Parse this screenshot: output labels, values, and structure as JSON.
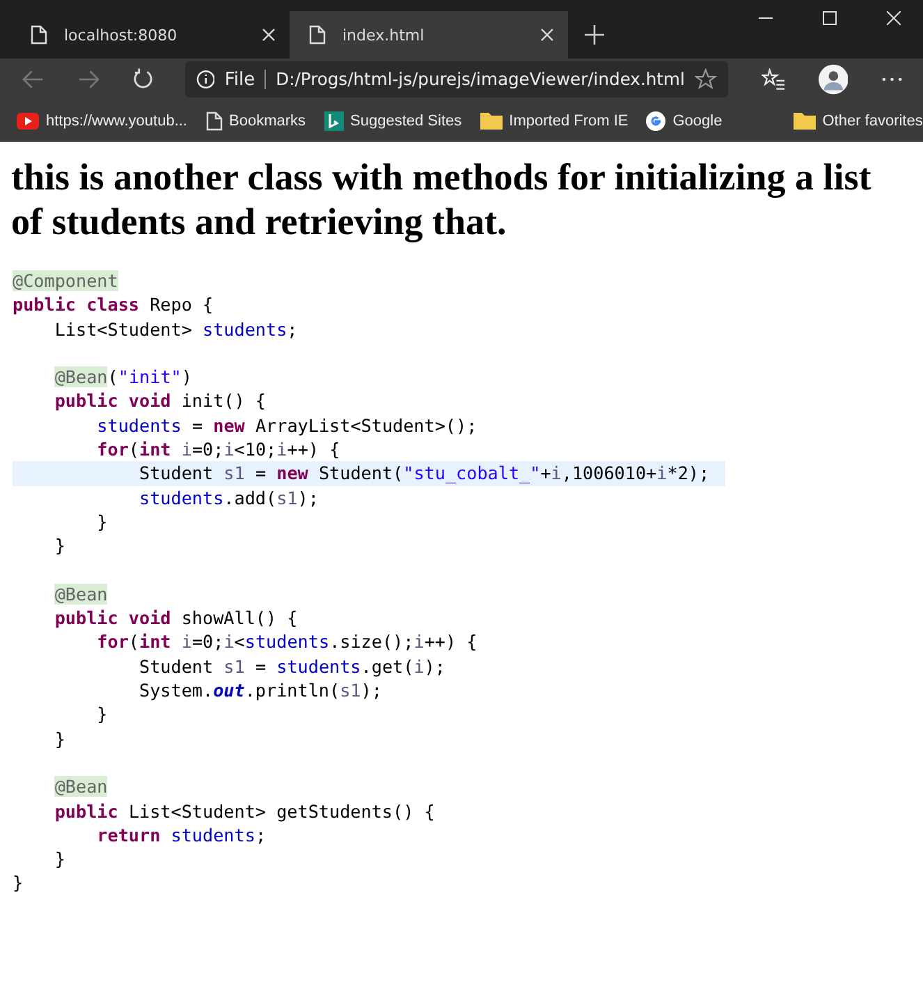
{
  "browser": {
    "tabs": [
      {
        "label": "localhost:8080",
        "selected": false
      },
      {
        "label": "index.html",
        "selected": true
      }
    ],
    "address": {
      "scheme": "File",
      "url": "D:/Progs/html-js/purejs/imageViewer/index.html"
    },
    "bookmarks": [
      {
        "label": "https://www.youtub...",
        "kind": "youtube"
      },
      {
        "label": "Bookmarks",
        "kind": "page"
      },
      {
        "label": "Suggested Sites",
        "kind": "bing"
      },
      {
        "label": "Imported From IE",
        "kind": "folder"
      },
      {
        "label": "Google",
        "kind": "google"
      }
    ],
    "other_favorites": "Other favorites"
  },
  "page": {
    "heading": "this is another class with methods for initializing a list of students and retrieving that.",
    "code": [
      {
        "kind": "code",
        "highlighted": false,
        "tokens": [
          {
            "text": "@Component",
            "kind": "ann"
          }
        ]
      },
      {
        "kind": "code",
        "highlighted": false,
        "tokens": [
          {
            "text": "public class",
            "kind": "kw"
          },
          {
            "text": " Repo {",
            "kind": "p"
          }
        ]
      },
      {
        "kind": "code",
        "highlighted": false,
        "tokens": [
          {
            "text": "    List<Student> ",
            "kind": "p"
          },
          {
            "text": "students",
            "kind": "field"
          },
          {
            "text": ";",
            "kind": "p"
          }
        ]
      },
      {
        "kind": "blank"
      },
      {
        "kind": "code",
        "highlighted": false,
        "tokens": [
          {
            "text": "    @Bean",
            "kind": "ann"
          },
          {
            "text": "(",
            "kind": "p"
          },
          {
            "text": "\"init\"",
            "kind": "str"
          },
          {
            "text": ")",
            "kind": "p"
          }
        ]
      },
      {
        "kind": "code",
        "highlighted": false,
        "tokens": [
          {
            "text": "    public void",
            "kind": "kw"
          },
          {
            "text": " init() {",
            "kind": "p"
          }
        ]
      },
      {
        "kind": "code",
        "highlighted": false,
        "tokens": [
          {
            "text": "        students",
            "kind": "field"
          },
          {
            "text": " = ",
            "kind": "p"
          },
          {
            "text": "new",
            "kind": "kw"
          },
          {
            "text": " ArrayList<Student>();",
            "kind": "p"
          }
        ]
      },
      {
        "kind": "code",
        "highlighted": false,
        "tokens": [
          {
            "text": "        for",
            "kind": "kw"
          },
          {
            "text": "(",
            "kind": "p"
          },
          {
            "text": "int",
            "kind": "kw"
          },
          {
            "text": " i",
            "kind": "local"
          },
          {
            "text": "=0;",
            "kind": "p"
          },
          {
            "text": "i",
            "kind": "local"
          },
          {
            "text": "<10;",
            "kind": "p"
          },
          {
            "text": "i",
            "kind": "local"
          },
          {
            "text": "++) {",
            "kind": "p"
          }
        ]
      },
      {
        "kind": "code",
        "highlighted": true,
        "tokens": [
          {
            "text": "            Student ",
            "kind": "p"
          },
          {
            "text": "s1",
            "kind": "local"
          },
          {
            "text": " = ",
            "kind": "p"
          },
          {
            "text": "new",
            "kind": "kw"
          },
          {
            "text": " Student(",
            "kind": "p"
          },
          {
            "text": "\"stu_cobalt_\"",
            "kind": "str"
          },
          {
            "text": "+",
            "kind": "p"
          },
          {
            "text": "i",
            "kind": "local"
          },
          {
            "text": ",1006010+",
            "kind": "p"
          },
          {
            "text": "i",
            "kind": "local"
          },
          {
            "text": "*2);",
            "kind": "p"
          }
        ]
      },
      {
        "kind": "code",
        "highlighted": false,
        "tokens": [
          {
            "text": "            students",
            "kind": "field"
          },
          {
            "text": ".add(",
            "kind": "p"
          },
          {
            "text": "s1",
            "kind": "local"
          },
          {
            "text": ");",
            "kind": "p"
          }
        ]
      },
      {
        "kind": "code",
        "highlighted": false,
        "tokens": [
          {
            "text": "        }",
            "kind": "p"
          }
        ]
      },
      {
        "kind": "code",
        "highlighted": false,
        "tokens": [
          {
            "text": "    }",
            "kind": "p"
          }
        ]
      },
      {
        "kind": "blank"
      },
      {
        "kind": "code",
        "highlighted": false,
        "tokens": [
          {
            "text": "    @Bean",
            "kind": "ann"
          }
        ]
      },
      {
        "kind": "code",
        "highlighted": false,
        "tokens": [
          {
            "text": "    public void",
            "kind": "kw"
          },
          {
            "text": " showAll() {",
            "kind": "p"
          }
        ]
      },
      {
        "kind": "code",
        "highlighted": false,
        "tokens": [
          {
            "text": "        for",
            "kind": "kw"
          },
          {
            "text": "(",
            "kind": "p"
          },
          {
            "text": "int",
            "kind": "kw"
          },
          {
            "text": " i",
            "kind": "local"
          },
          {
            "text": "=0;",
            "kind": "p"
          },
          {
            "text": "i",
            "kind": "local"
          },
          {
            "text": "<",
            "kind": "p"
          },
          {
            "text": "students",
            "kind": "field"
          },
          {
            "text": ".size();",
            "kind": "p"
          },
          {
            "text": "i",
            "kind": "local"
          },
          {
            "text": "++) {",
            "kind": "p"
          }
        ]
      },
      {
        "kind": "code",
        "highlighted": false,
        "tokens": [
          {
            "text": "            Student ",
            "kind": "p"
          },
          {
            "text": "s1",
            "kind": "local"
          },
          {
            "text": " = ",
            "kind": "p"
          },
          {
            "text": "students",
            "kind": "field"
          },
          {
            "text": ".get(",
            "kind": "p"
          },
          {
            "text": "i",
            "kind": "local"
          },
          {
            "text": ");",
            "kind": "p"
          }
        ]
      },
      {
        "kind": "code",
        "highlighted": false,
        "tokens": [
          {
            "text": "            System.",
            "kind": "p"
          },
          {
            "text": "out",
            "kind": "static"
          },
          {
            "text": ".println(",
            "kind": "p"
          },
          {
            "text": "s1",
            "kind": "local"
          },
          {
            "text": ");",
            "kind": "p"
          }
        ]
      },
      {
        "kind": "code",
        "highlighted": false,
        "tokens": [
          {
            "text": "        }",
            "kind": "p"
          }
        ]
      },
      {
        "kind": "code",
        "highlighted": false,
        "tokens": [
          {
            "text": "    }",
            "kind": "p"
          }
        ]
      },
      {
        "kind": "blank"
      },
      {
        "kind": "code",
        "highlighted": false,
        "tokens": [
          {
            "text": "    @Bean",
            "kind": "ann"
          }
        ]
      },
      {
        "kind": "code",
        "highlighted": false,
        "tokens": [
          {
            "text": "    public",
            "kind": "kw"
          },
          {
            "text": " List<Student> getStudents() {",
            "kind": "p"
          }
        ]
      },
      {
        "kind": "code",
        "highlighted": false,
        "tokens": [
          {
            "text": "        return",
            "kind": "kw"
          },
          {
            "text": " students",
            "kind": "field"
          },
          {
            "text": ";",
            "kind": "p"
          }
        ]
      },
      {
        "kind": "code",
        "highlighted": false,
        "tokens": [
          {
            "text": "    }",
            "kind": "p"
          }
        ]
      },
      {
        "kind": "code",
        "highlighted": false,
        "tokens": [
          {
            "text": "}",
            "kind": "p"
          }
        ]
      }
    ]
  }
}
